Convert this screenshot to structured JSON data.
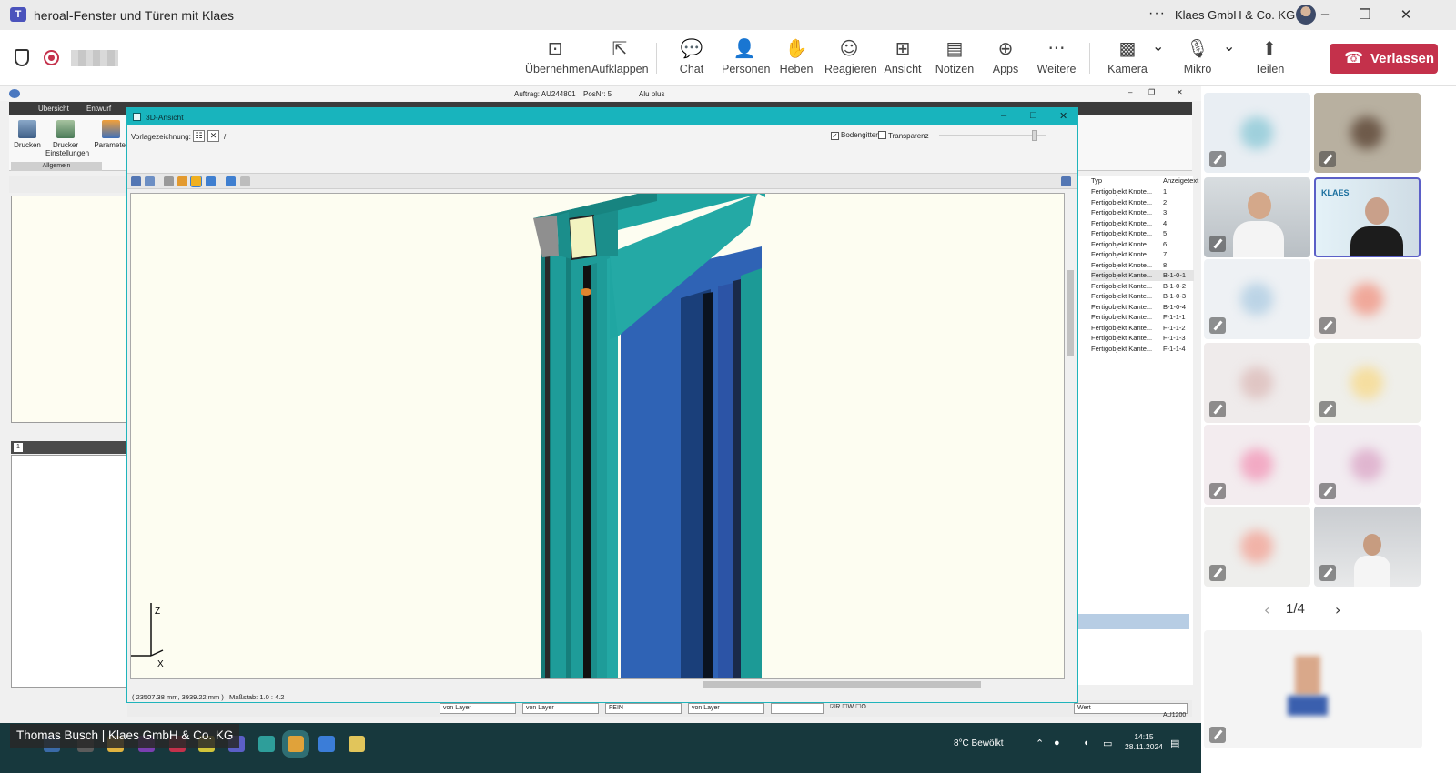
{
  "window": {
    "title": "heroal-Fenster und Türen mit Klaes",
    "org_name": "Klaes GmbH & Co. KG",
    "more_glyph": "···"
  },
  "toolbar": {
    "items": [
      {
        "label": "Übernehmen",
        "icon": "share-screen-icon",
        "glyph": "⊡"
      },
      {
        "label": "Aufklappen",
        "icon": "pop-out-icon",
        "glyph": "⇱"
      },
      {
        "label": "Chat",
        "icon": "chat-icon",
        "glyph": "💬"
      },
      {
        "label": "Personen",
        "icon": "people-icon",
        "glyph": "👤"
      },
      {
        "label": "Heben",
        "icon": "raise-hand-icon",
        "glyph": "✋"
      },
      {
        "label": "Reagieren",
        "icon": "react-icon",
        "glyph": "☺"
      },
      {
        "label": "Ansicht",
        "icon": "view-icon",
        "glyph": "⊞"
      },
      {
        "label": "Notizen",
        "icon": "notes-icon",
        "glyph": "▤"
      },
      {
        "label": "Apps",
        "icon": "apps-icon",
        "glyph": "⊕"
      },
      {
        "label": "Weitere",
        "icon": "more-icon",
        "glyph": "···"
      },
      {
        "label": "Kamera",
        "icon": "camera-off-icon",
        "glyph": "▩"
      },
      {
        "label": "Mikro",
        "icon": "mic-off-icon",
        "glyph": "🎙"
      },
      {
        "label": "Teilen",
        "icon": "share-icon",
        "glyph": "⬆"
      }
    ],
    "leave_label": "Verlassen",
    "leave_color": "#c4314b",
    "chevron_glyph": "⌄"
  },
  "cad": {
    "header": {
      "auftrag": "Auftrag: AU244801",
      "posnr": "PosNr: 5",
      "system": "Alu plus"
    },
    "tabs": [
      "Übersicht",
      "Entwurf"
    ],
    "ribbon": [
      {
        "label": "Drucken",
        "icon": "printer-icon"
      },
      {
        "label": "Drucker Einstellungen",
        "icon": "printer-settings-icon"
      },
      {
        "label": "Parameter",
        "icon": "parameter-icon"
      }
    ],
    "ribbon_group": "Allgemein",
    "left_tab_number": "1",
    "right_panel": {
      "headers": [
        "Typ",
        "Anzeigetext"
      ],
      "rows": [
        [
          "Fertigobjekt Knote...",
          "1"
        ],
        [
          "Fertigobjekt Knote...",
          "2"
        ],
        [
          "Fertigobjekt Knote...",
          "3"
        ],
        [
          "Fertigobjekt Knote...",
          "4"
        ],
        [
          "Fertigobjekt Knote...",
          "5"
        ],
        [
          "Fertigobjekt Knote...",
          "6"
        ],
        [
          "Fertigobjekt Knote...",
          "7"
        ],
        [
          "Fertigobjekt Knote...",
          "8"
        ],
        [
          "Fertigobjekt Kante...",
          "B-1-0-1"
        ],
        [
          "Fertigobjekt Kante...",
          "B-1-0-2"
        ],
        [
          "Fertigobjekt Kante...",
          "B-1-0-3"
        ],
        [
          "Fertigobjekt Kante...",
          "B-1-0-4"
        ],
        [
          "Fertigobjekt Kante...",
          "F-1-1-1"
        ],
        [
          "Fertigobjekt Kante...",
          "F-1-1-2"
        ],
        [
          "Fertigobjekt Kante...",
          "F-1-1-3"
        ],
        [
          "Fertigobjekt Kante...",
          "F-1-1-4"
        ]
      ]
    },
    "bottom_dropdowns": [
      "von Layer",
      "von Layer",
      "FEIN",
      "von Layer"
    ],
    "bottom_flags": "☑R ☐W ☐O",
    "bottom_wert": "Wert",
    "bottom_code": "AU1200"
  },
  "view3d": {
    "title": "3D-Ansicht",
    "vorlage_label": "Vorlagezeichnung:",
    "vorlage_value": "/",
    "bodengitter_label": "Bodengitter",
    "bodengitter_checked": true,
    "transparenz_label": "Transparenz",
    "transparenz_checked": false,
    "coords": "( 23507.38 mm, 3939.22 mm )",
    "scale": "Maßstab: 1.0 : 4.2",
    "axis_z": "Z",
    "axis_x": "X",
    "colors": {
      "frame": "#1b9b98",
      "glass": "#2f63b5",
      "background": "#fdfdf1"
    }
  },
  "taskbar": {
    "weather": "8°C  Bewölkt",
    "time": "14:15",
    "date": "28.11.2024"
  },
  "presenter": "Thomas Busch | Klaes GmbH & Co. KG",
  "gallery": {
    "pager": "1/4",
    "prev_glyph": "‹",
    "next_glyph": "›",
    "klaes_badge": "KLAES"
  }
}
